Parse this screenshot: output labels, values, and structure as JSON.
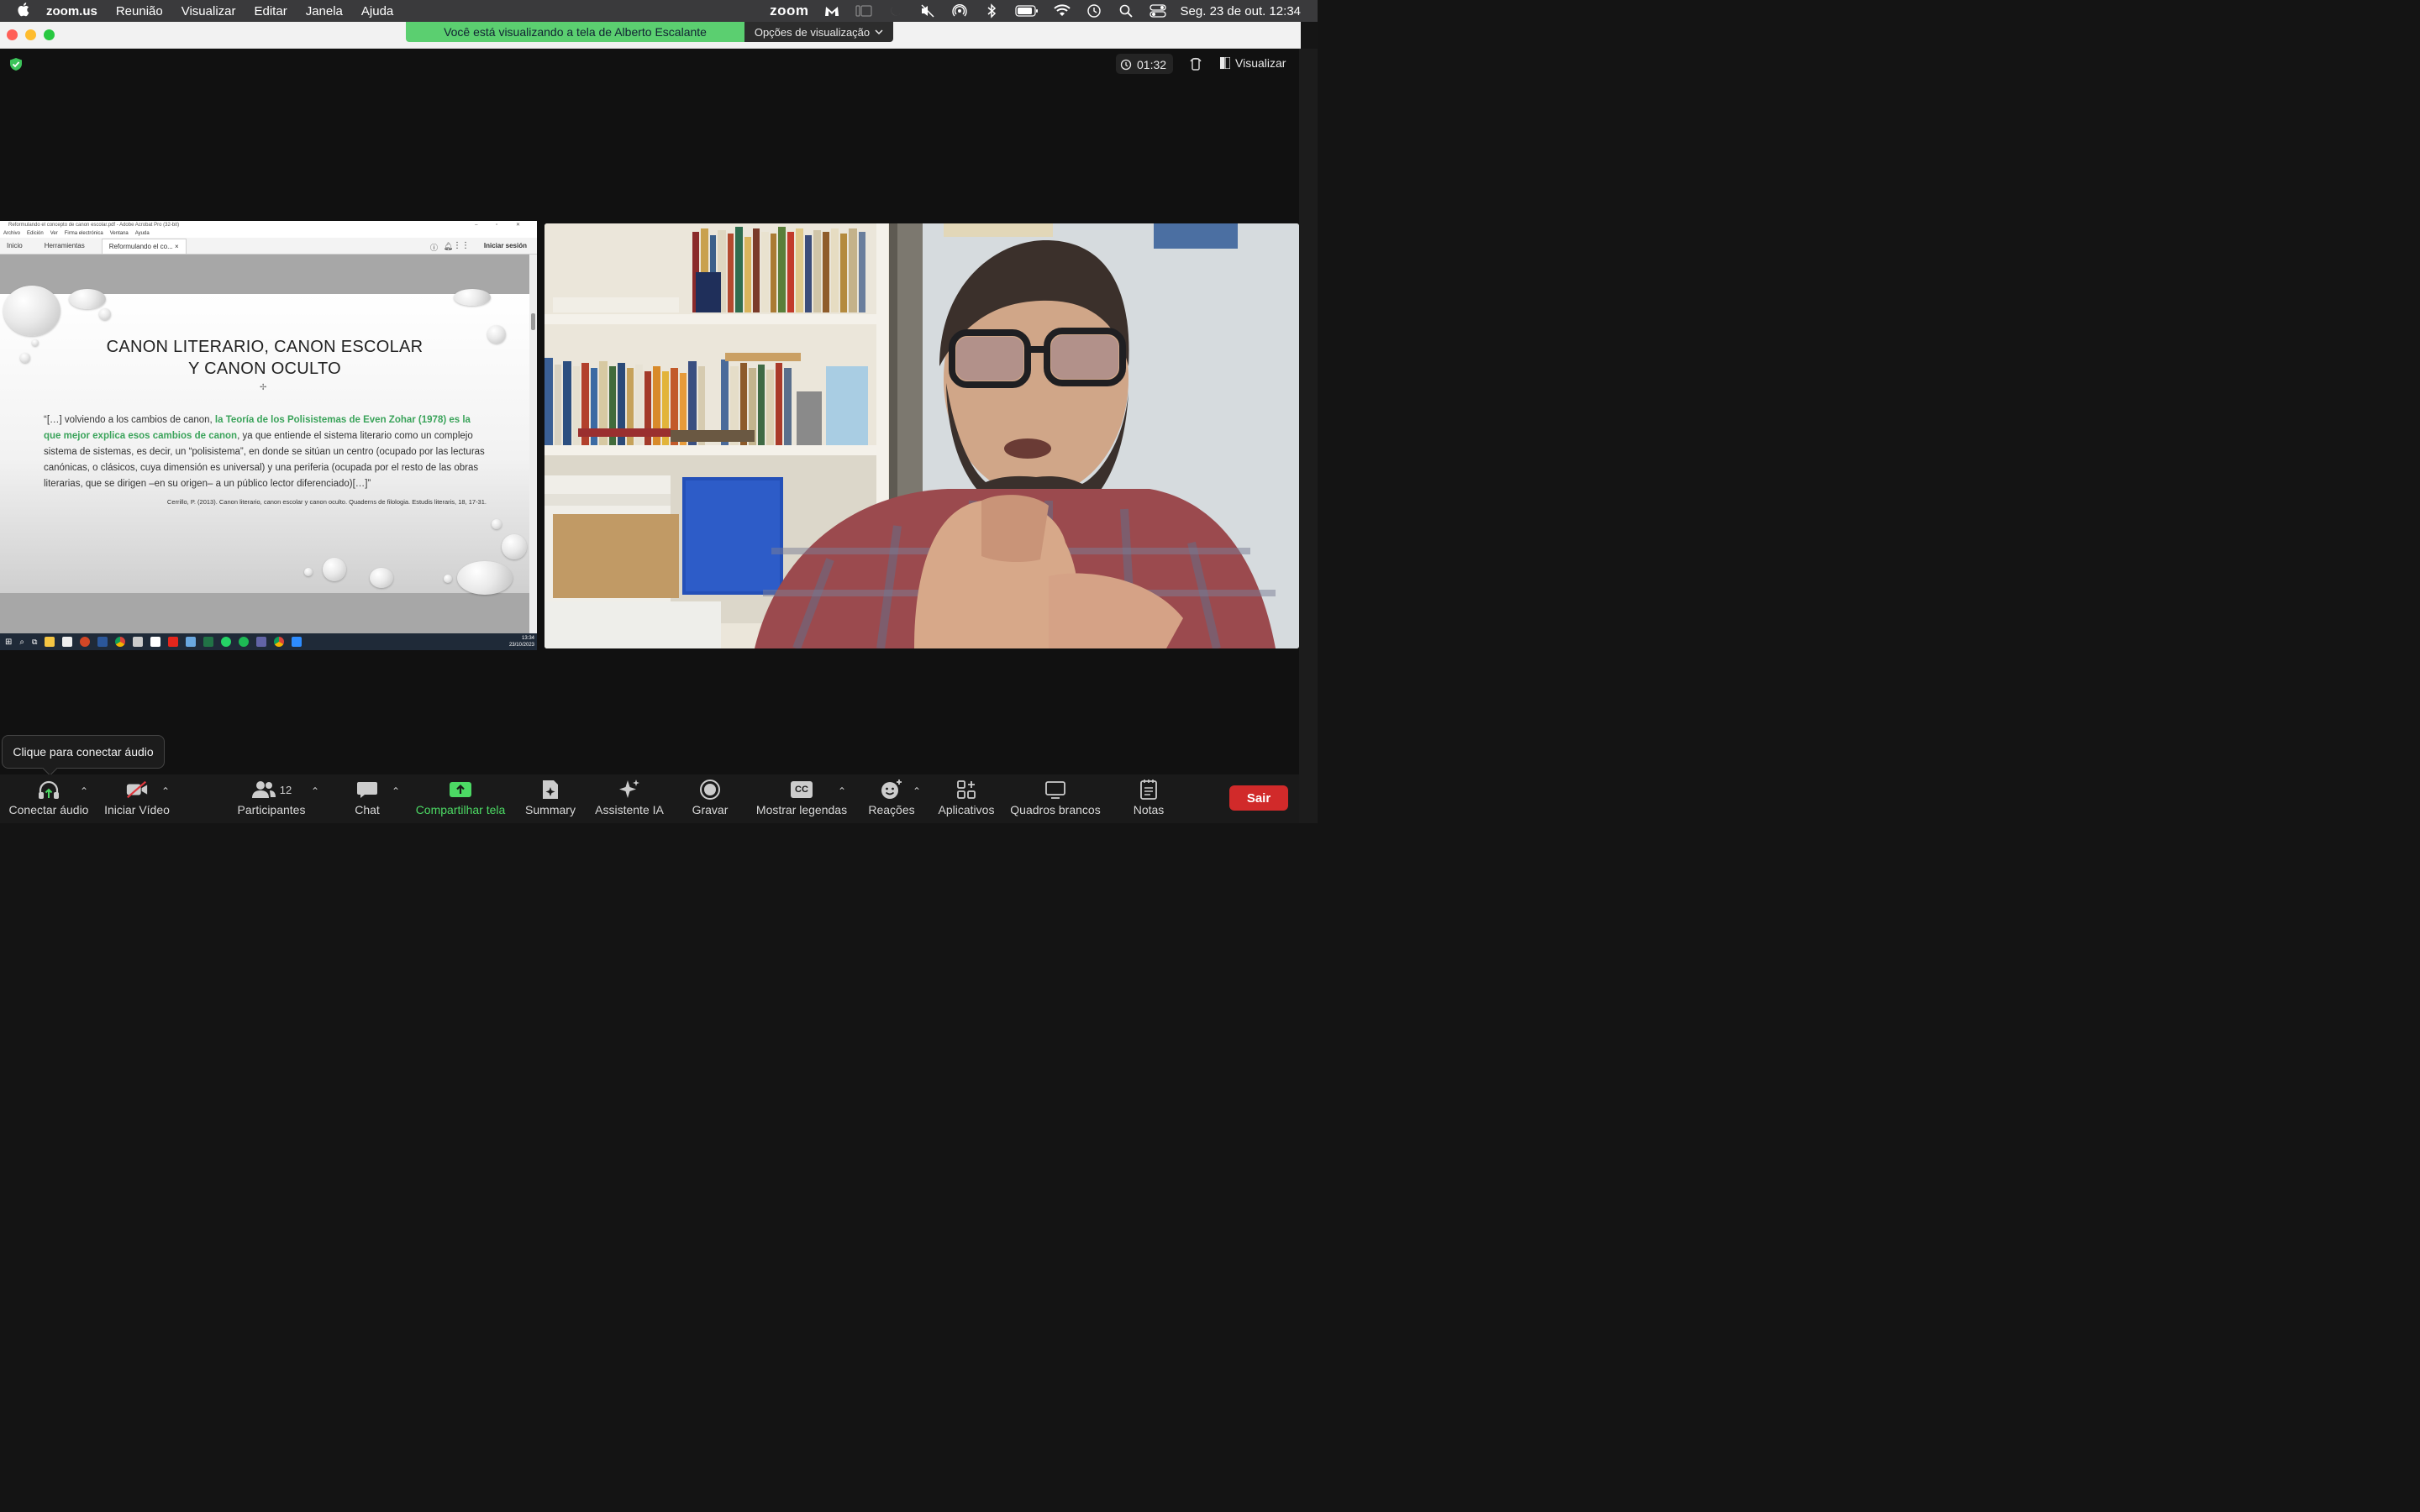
{
  "menubar": {
    "app": "zoom.us",
    "items": [
      "Reunião",
      "Visualizar",
      "Editar",
      "Janela",
      "Ajuda"
    ],
    "zoom_logo": "zoom",
    "clock": "Seg. 23 de out.  12:34"
  },
  "window": {
    "banner": "Você está visualizando a tela de Alberto Escalante",
    "view_options": "Opções de visualização"
  },
  "meeting": {
    "timer": "01:32",
    "view_label": "Visualizar"
  },
  "shared_screen": {
    "acrobat_title": "Reformulando el concepto de canon escolar.pdf - Adobe Acrobat Pro (32-bit)",
    "acrobat_menu": [
      "Archivo",
      "Edición",
      "Ver",
      "Firma electrónica",
      "Ventana",
      "Ayuda"
    ],
    "tabs": [
      "Inicio",
      "Herramientas",
      "Reformulando el co..."
    ],
    "sign_in": "Iniciar sesión",
    "slide_title_1": "CANON LITERARIO, CANON ESCOLAR",
    "slide_title_2": "Y CANON OCULTO",
    "quote_start": "“[…] volviendo a los cambios de canon, ",
    "quote_highlight": "la Teoría de los Polisistemas de Even Zohar (1978) es la que mejor explica esos cambios de canon",
    "quote_end": ", ya que entiende el sistema literario como un complejo sistema de sistemas, es decir, un “polisistema”, en donde se sitúan un centro (ocupado por las lecturas canónicas, o clásicos, cuya dimensión es universal) y una periferia (ocupada por el resto de las obras literarias, que se dirigen –en su origen– a un público lector diferenciado)[…]”",
    "citation": "Cerrillo, P. (2013). Canon literario, canon escolar y canon oculto. Quaderns de filologia. Estudis literaris, 18, 17-31.",
    "taskbar_time": "13:34",
    "taskbar_date": "23/10/2023"
  },
  "tooltip": "Clique para conectar áudio",
  "toolbar": {
    "audio": "Conectar áudio",
    "video": "Iniciar Vídeo",
    "participants": "Participantes",
    "participants_count": "12",
    "chat": "Chat",
    "share": "Compartilhar tela",
    "summary": "Summary",
    "ai": "Assistente IA",
    "record": "Gravar",
    "captions": "Mostrar legendas",
    "cc": "CC",
    "reactions": "Reações",
    "apps": "Aplicativos",
    "whiteboards": "Quadros brancos",
    "notes": "Notas",
    "leave": "Sair"
  },
  "colors": {
    "banner": "#5bcf70",
    "share_green": "#4cd964",
    "leave_red": "#d12a2a",
    "quote_highlight": "#3aa35a"
  }
}
